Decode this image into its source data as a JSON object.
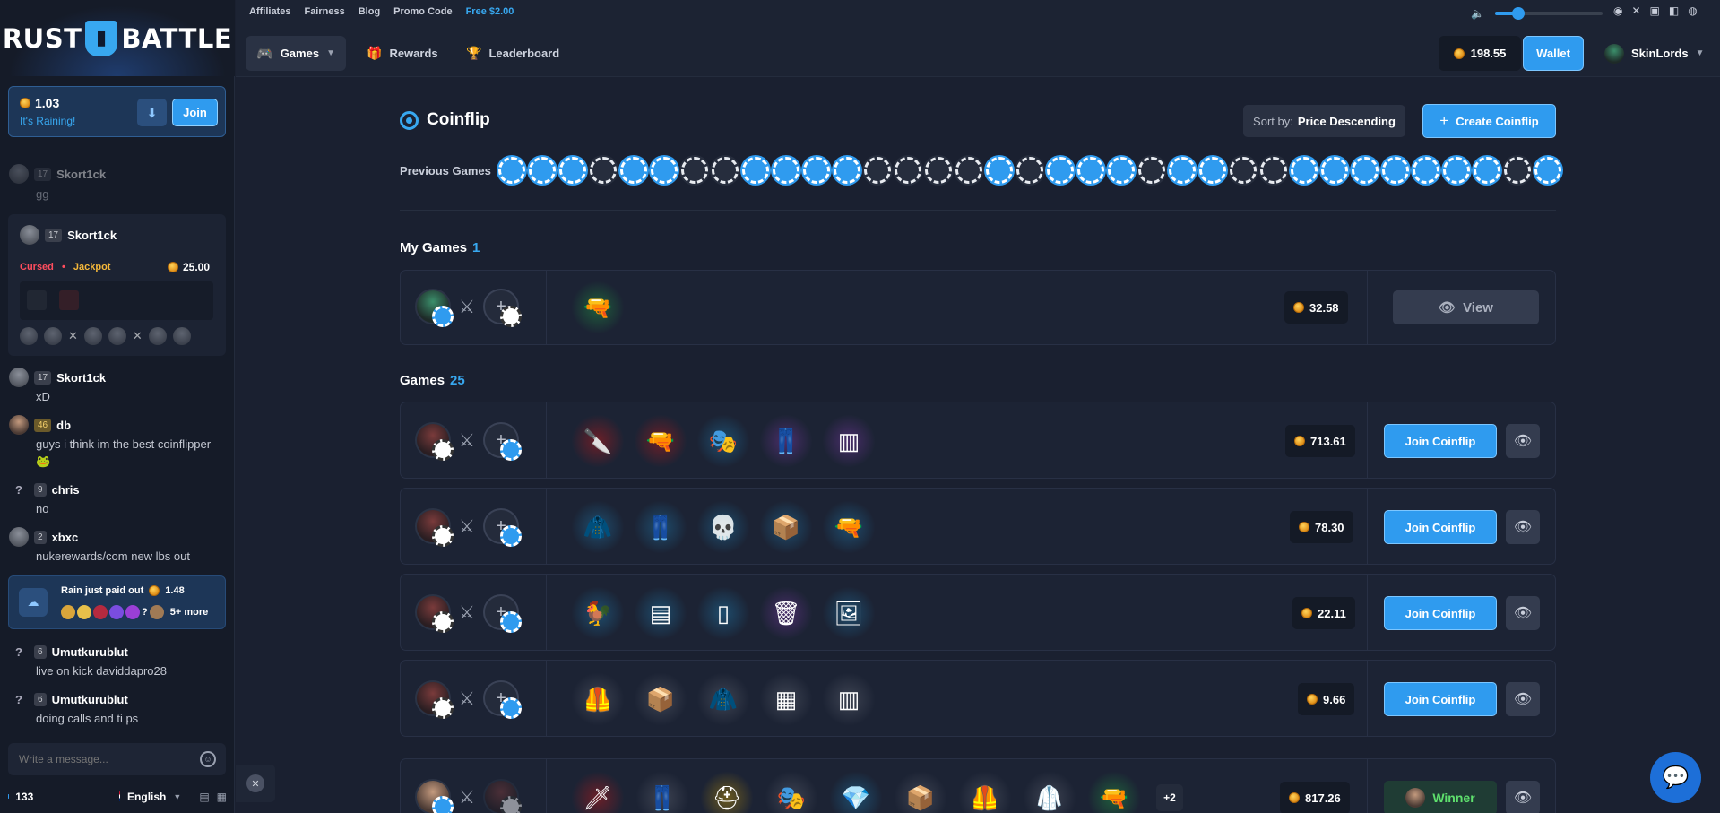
{
  "brand": {
    "left": "RUST",
    "right": "BATTLE"
  },
  "top_links": [
    "Affiliates",
    "Fairness",
    "Blog",
    "Promo Code",
    "Free $2.00"
  ],
  "nav": {
    "games": "Games",
    "rewards": "Rewards",
    "leaderboard": "Leaderboard"
  },
  "wallet": {
    "balance": "198.55",
    "button": "Wallet"
  },
  "user": {
    "name": "SkinLords"
  },
  "volume_level": 0.22,
  "rain": {
    "amount": "1.03",
    "status": "It's Raining!",
    "join": "Join"
  },
  "chat": {
    "messages": [
      {
        "level": "17",
        "user": "Skort1ck",
        "text": "gg"
      },
      {
        "level": "17",
        "user": "Skort1ck",
        "text": "xD"
      },
      {
        "level": "46",
        "user": "db",
        "text": "guys i think im the best coinflipper 🐸"
      },
      {
        "level": "9",
        "user": "chris",
        "text": "no"
      },
      {
        "level": "2",
        "user": "xbxc",
        "text": "nukerewards/com new lbs out"
      },
      {
        "level": "6",
        "user": "Umutkurublut",
        "text": "live on kick daviddapro28"
      },
      {
        "level": "6",
        "user": "Umutkurublut",
        "text": "doing calls and ti ps"
      }
    ],
    "jackpot_card": {
      "level": "17",
      "user": "Skort1ck",
      "tag1": "Cursed",
      "tag2": "Jackpot",
      "amount": "25.00"
    },
    "rain_paid": {
      "text": "Rain just paid out",
      "amount": "1.48",
      "more": "5+ more"
    },
    "input_placeholder": "Write a message...",
    "online": "133",
    "language": "English"
  },
  "coinflip": {
    "title": "Coinflip",
    "sort_label": "Sort by:",
    "sort_value": "Price Descending",
    "create": "Create Coinflip",
    "previous_label": "Previous Games",
    "previous_games": [
      "blue",
      "blue",
      "blue",
      "white",
      "blue",
      "blue",
      "white",
      "white",
      "blue",
      "blue",
      "blue",
      "blue",
      "white",
      "white",
      "white",
      "white",
      "blue",
      "white",
      "blue",
      "blue",
      "blue",
      "white",
      "blue",
      "blue",
      "white",
      "white",
      "blue",
      "blue",
      "blue",
      "blue",
      "blue",
      "blue",
      "blue",
      "white",
      "blue"
    ],
    "my_games_label": "My Games",
    "my_games_count": "1",
    "games_label": "Games",
    "games_count": "25",
    "join_label": "Join Coinflip",
    "view_label": "View",
    "winner_label": "Winner",
    "my_game": {
      "price": "32.58"
    },
    "games": [
      {
        "price": "713.61"
      },
      {
        "price": "78.30"
      },
      {
        "price": "22.11"
      },
      {
        "price": "9.66"
      },
      {
        "price": "817.26",
        "extra_items": "+2"
      }
    ]
  },
  "colors": {
    "accent": "#2f9bef",
    "bg": "#1a2030",
    "winner": "#5ee06d",
    "cursed": "#ff4d5e",
    "jackpot": "#f5b83a"
  }
}
